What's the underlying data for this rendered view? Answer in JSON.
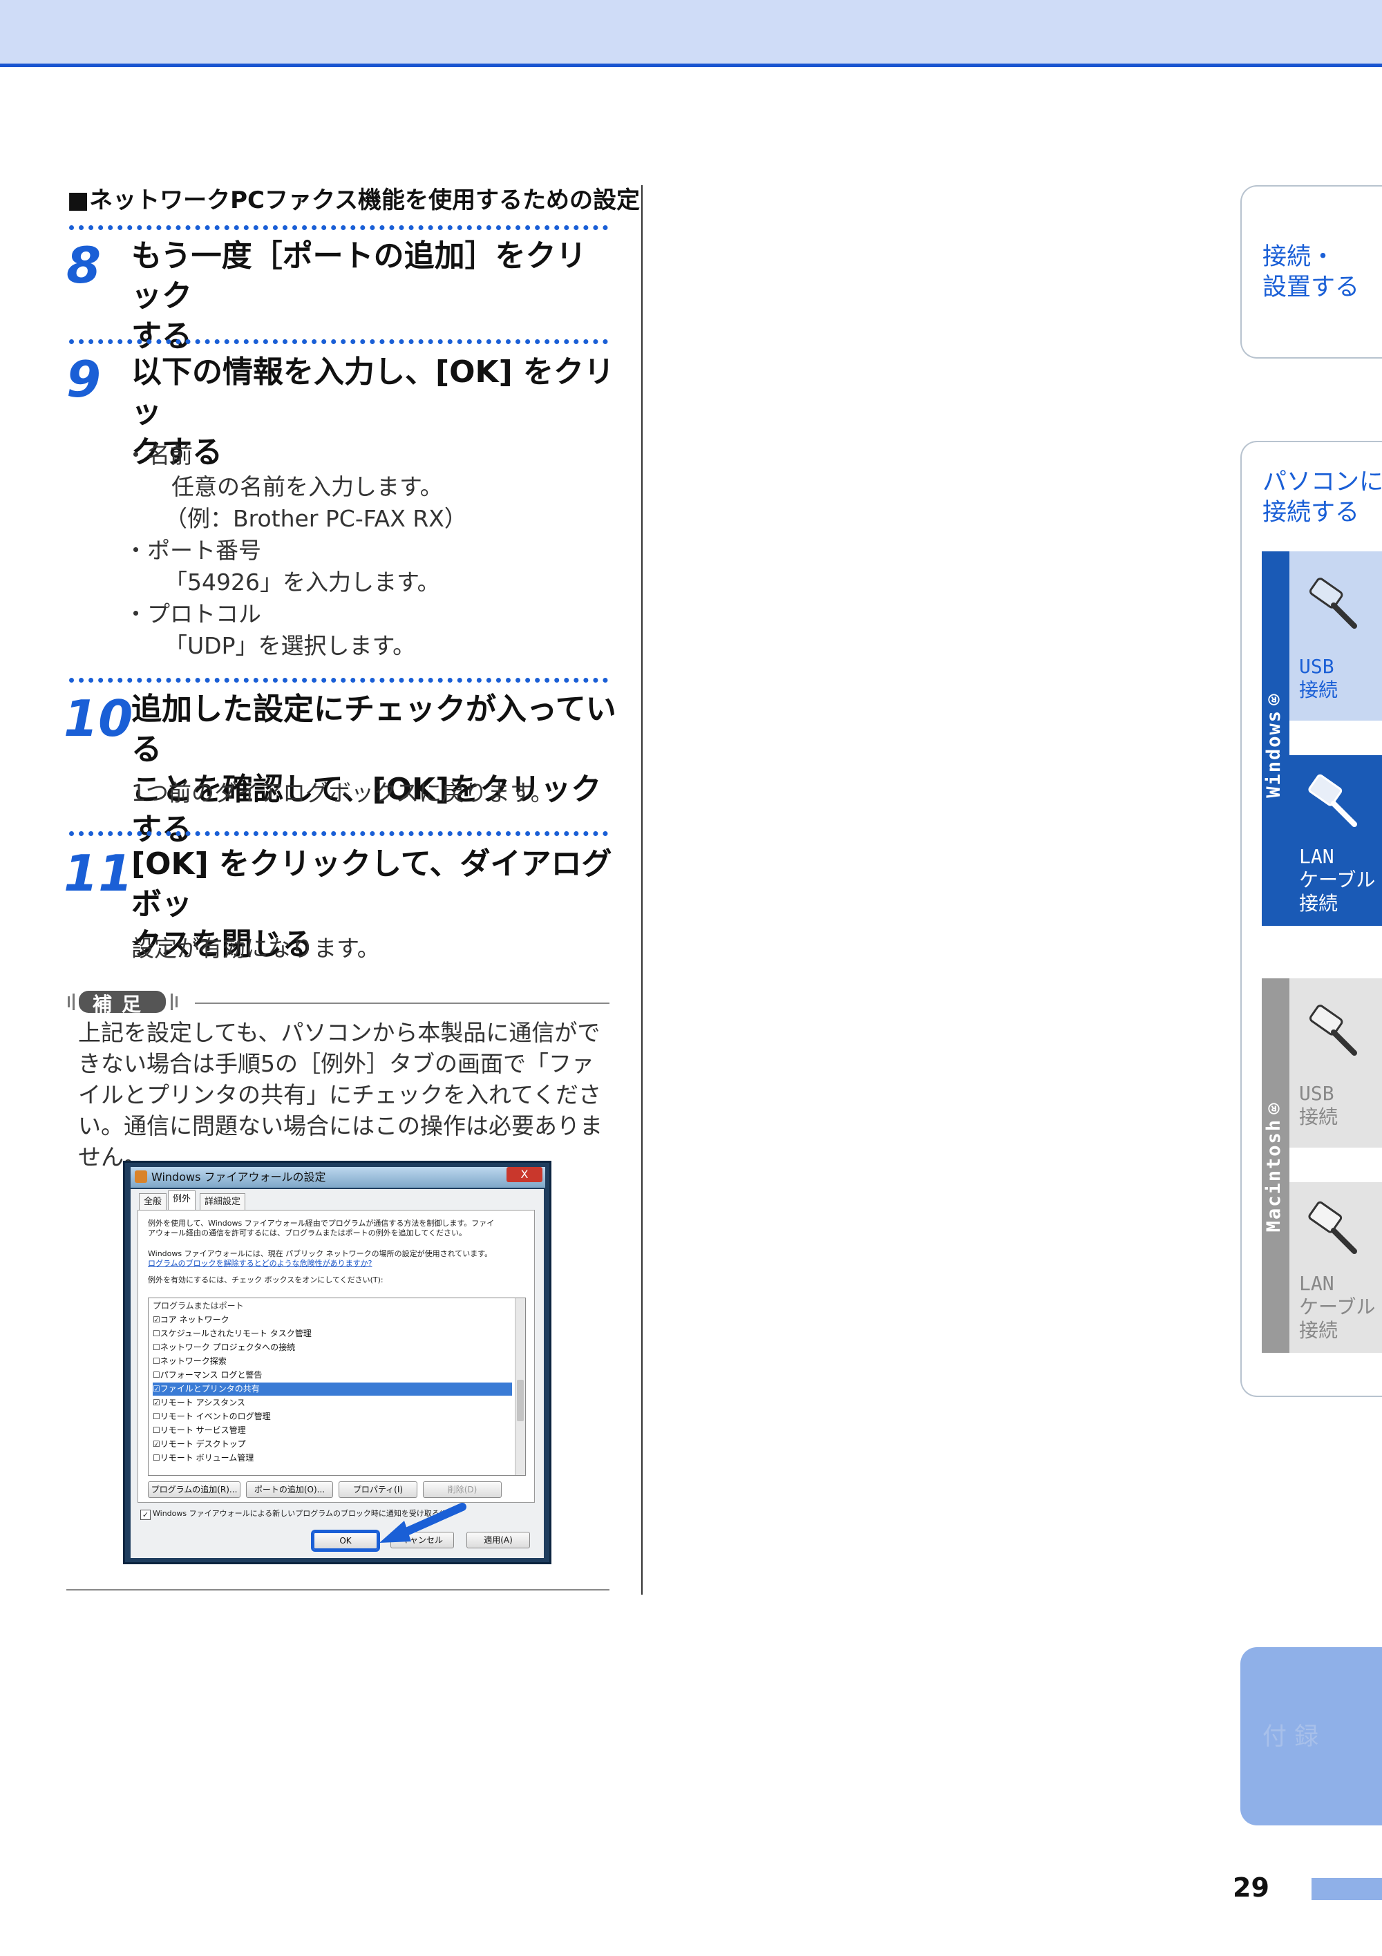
{
  "section_heading": "■ネットワークPCファクス機能を使用するための設定",
  "steps": [
    {
      "num": "8",
      "line1": "もう一度［ポートの追加］をクリック",
      "line2": "する"
    },
    {
      "num": "9",
      "line1": "以下の情報を入力し、[OK] をクリッ",
      "line2": "クする"
    },
    {
      "num": "10",
      "line1": "追加した設定にチェックが入っている",
      "line2": "ことを確認して、[OK]をクリックする"
    },
    {
      "num": "11",
      "line1": "[OK] をクリックして、ダイアログボッ",
      "line2": "クスを閉じる"
    }
  ],
  "step9_bullets": [
    {
      "label": "・名前",
      "lines": [
        "任意の名前を入力します。",
        "（例：Brother PC-FAX RX）"
      ]
    },
    {
      "label": "・ポート番号",
      "lines": [
        "「54926」を入力します。"
      ]
    },
    {
      "label": "・プロトコル",
      "lines": [
        "「UDP」を選択します。"
      ]
    }
  ],
  "step10_desc": "1つ前のダイアログボックスに戻ります。",
  "step11_desc": "設定が有効になります。",
  "note_badge": "補足",
  "note_text": "上記を設定しても、パソコンから本製品に通信ができない場合は手順5の［例外］タブの画面で「ファイルとプリンタの共有」にチェックを入れてください。通信に問題ない場合にはこの操作は必要ありません。",
  "dialog": {
    "title": "Windows ファイアウォールの設定",
    "close": "X",
    "tabs": [
      "全般",
      "例外",
      "詳細設定"
    ],
    "para1_line1": "例外を使用して、Windows ファイアウォール経由でプログラムが通信する方法を制御します。ファイ",
    "para1_line2": "アウォール経由の通信を許可するには、プログラムまたはポートの例外を追加してください。",
    "para2_line1": "Windows ファイアウォールには、現在 パブリック ネットワークの場所の設定が使用されています。",
    "para2_link": "ログラムのブロックを解除するとどのような危険性がありますか?",
    "para3": "例外を有効にするには、チェック ボックスをオンにしてください(T):",
    "list_header": "プログラムまたはポート",
    "list_items": [
      {
        "checked": true,
        "label": "コア ネットワーク"
      },
      {
        "checked": false,
        "label": "スケジュールされたリモート タスク管理"
      },
      {
        "checked": false,
        "label": "ネットワーク プロジェクタへの接続"
      },
      {
        "checked": false,
        "label": "ネットワーク探索"
      },
      {
        "checked": false,
        "label": "パフォーマンス ログと警告"
      },
      {
        "checked": true,
        "label": "ファイルとプリンタの共有"
      },
      {
        "checked": true,
        "label": "リモート アシスタンス"
      },
      {
        "checked": false,
        "label": "リモート イベントのログ管理"
      },
      {
        "checked": false,
        "label": "リモート サービス管理"
      },
      {
        "checked": true,
        "label": "リモート デスクトップ"
      },
      {
        "checked": false,
        "label": "リモート ボリューム管理"
      }
    ],
    "selected_index": 5,
    "buttons": {
      "add_program": "プログラムの追加(R)...",
      "add_port": "ポートの追加(O)...",
      "properties": "プロパティ(I)",
      "delete": "削除(D)"
    },
    "notify_checkbox": "Windows ファイアウォールによる新しいプログラムのブロック時に通知を受け取る(B)",
    "ok": "OK",
    "cancel": "キャンセル",
    "apply": "適用(A)"
  },
  "side_tabs": {
    "connect_setup": "接続・\n設置する",
    "pc_connect": "パソコンに\n接続する",
    "windows_label": "Windows®",
    "macintosh_label": "Macintosh®",
    "usb": "USB\n接続",
    "lan": "LAN\nケーブル\n接続",
    "appendix": "付 録"
  },
  "colors": {
    "accent": "#1a5fd6",
    "windows_tab": "#1a5ab6",
    "windows_light": "#c7d7f2",
    "mac_tab": "#9a9a9a",
    "mac_light": "#e3e3e3",
    "appendix": "#8fb0e8"
  },
  "page_number": "29"
}
